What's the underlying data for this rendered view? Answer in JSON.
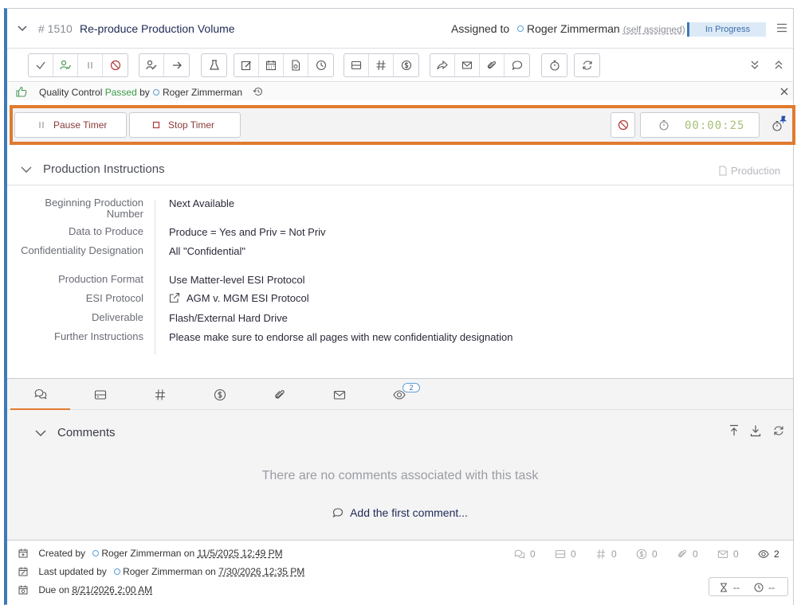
{
  "header": {
    "task_number": "# 1510",
    "title": "Re-produce Production Volume",
    "assigned_label": "Assigned to",
    "assignee": "Roger Zimmerman",
    "self_assigned": "(self assigned)",
    "status": "In Progress"
  },
  "qc": {
    "label": "Quality Control",
    "state": "Passed",
    "by": "by",
    "user": "Roger Zimmerman"
  },
  "timer": {
    "pause_label": "Pause Timer",
    "stop_label": "Stop Timer",
    "elapsed": "00:00:25"
  },
  "section": {
    "title": "Production Instructions",
    "right_label": "Production"
  },
  "fields": [
    {
      "label": "Beginning Production Number",
      "value": "Next Available"
    },
    {
      "label": "Data to Produce",
      "value": "Produce = Yes and Priv = Not Priv"
    },
    {
      "label": "Confidentiality Designation",
      "value": "All \"Confidential\""
    },
    {
      "label": "Production Format",
      "value": "Use Matter-level ESI Protocol"
    },
    {
      "label": "ESI Protocol",
      "value": "AGM v. MGM ESI Protocol"
    },
    {
      "label": "Deliverable",
      "value": "Flash/External Hard Drive"
    },
    {
      "label": "Further Instructions",
      "value": "Please make sure to endorse all pages with new confidentiality designation"
    }
  ],
  "tabs": {
    "watchers_badge": "2"
  },
  "comments": {
    "title": "Comments",
    "empty_text": "There are no comments associated with this task",
    "add_label": "Add the first comment..."
  },
  "footer": {
    "created_label": "Created by",
    "created_user": "Roger Zimmerman",
    "created_on": "on",
    "created_date": "11/5/2025 12:49 PM",
    "updated_label": "Last updated by",
    "updated_user": "Roger Zimmerman",
    "updated_on": "on",
    "updated_date": "7/30/2026 12:35 PM",
    "due_label": "Due on",
    "due_date": "8/21/2026 2:00 AM",
    "stats": {
      "comments": "0",
      "fields": "0",
      "numbers": "0",
      "billing": "0",
      "attachments": "0",
      "emails": "0",
      "watchers": "2"
    },
    "estimate": "--",
    "time_spent": "--"
  },
  "colors": {
    "accent": "#3d7ab8",
    "highlight": "#e07b2e",
    "passed": "#3a9a4a",
    "timer": "#a7c078"
  }
}
